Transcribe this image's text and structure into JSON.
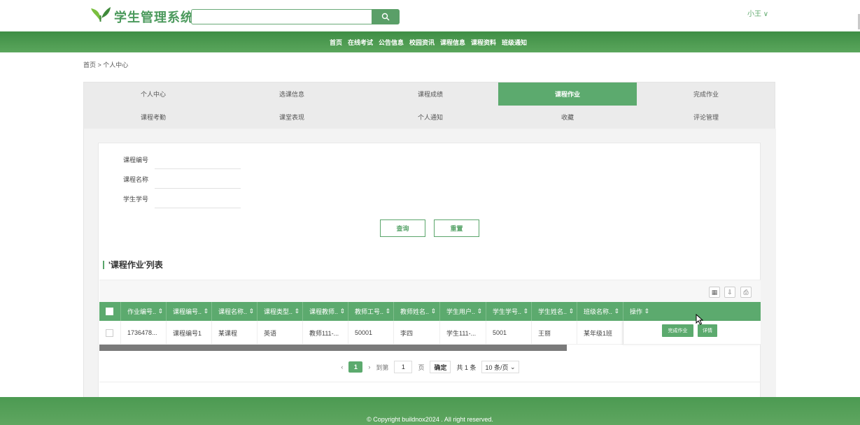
{
  "header": {
    "brand": "学生管理系统",
    "search": {
      "value": "",
      "placeholder": ""
    },
    "user": "小王 ∨"
  },
  "nav": [
    "首页",
    "在线考试",
    "公告信息",
    "校园资讯",
    "课程信息",
    "课程资料",
    "班级通知"
  ],
  "breadcrumb": "首页 > 个人中心",
  "tabs": [
    {
      "label": "个人中心"
    },
    {
      "label": "选课信息"
    },
    {
      "label": "课程成绩"
    },
    {
      "label": "课程作业",
      "active": true
    },
    {
      "label": "完成作业"
    },
    {
      "label": "课程考勤"
    },
    {
      "label": "课堂表现"
    },
    {
      "label": "个人通知"
    },
    {
      "label": "收藏"
    },
    {
      "label": "评论管理"
    }
  ],
  "filters": {
    "course_code": {
      "label": "课程编号",
      "value": ""
    },
    "course_name": {
      "label": "课程名称",
      "value": ""
    },
    "student_no": {
      "label": "学生学号",
      "value": ""
    },
    "search_label": "查询",
    "reset_label": "重置"
  },
  "list": {
    "title": "'课程作业'列表",
    "columns": [
      "作业编号..",
      "课程编号..",
      "课程名称..",
      "课程类型..",
      "课程教师..",
      "教师工号..",
      "教师姓名..",
      "学生用户..",
      "学生学号..",
      "学生姓名..",
      "班级名称..",
      "操作"
    ],
    "rows": [
      {
        "cells": [
          "1736478...",
          "课程编号1",
          "某课程",
          "英语",
          "教师111-...",
          "50001",
          "李四",
          "学生111-...",
          "5001",
          "王丽",
          "某年级1班"
        ],
        "complete_label": "完成作业",
        "detail_label": "详情"
      }
    ]
  },
  "pager": {
    "current": "1",
    "goto_label": "到第",
    "goto_value": "1",
    "page_unit": "页",
    "confirm_label": "确定",
    "total": "共 1 条",
    "page_size": "10 条/页"
  },
  "footer": {
    "copyright": "© Copyright buildnox2024 . All right reserved."
  },
  "colors": {
    "primary": "#5caa6e",
    "nav_bg": "#4c9a52"
  }
}
